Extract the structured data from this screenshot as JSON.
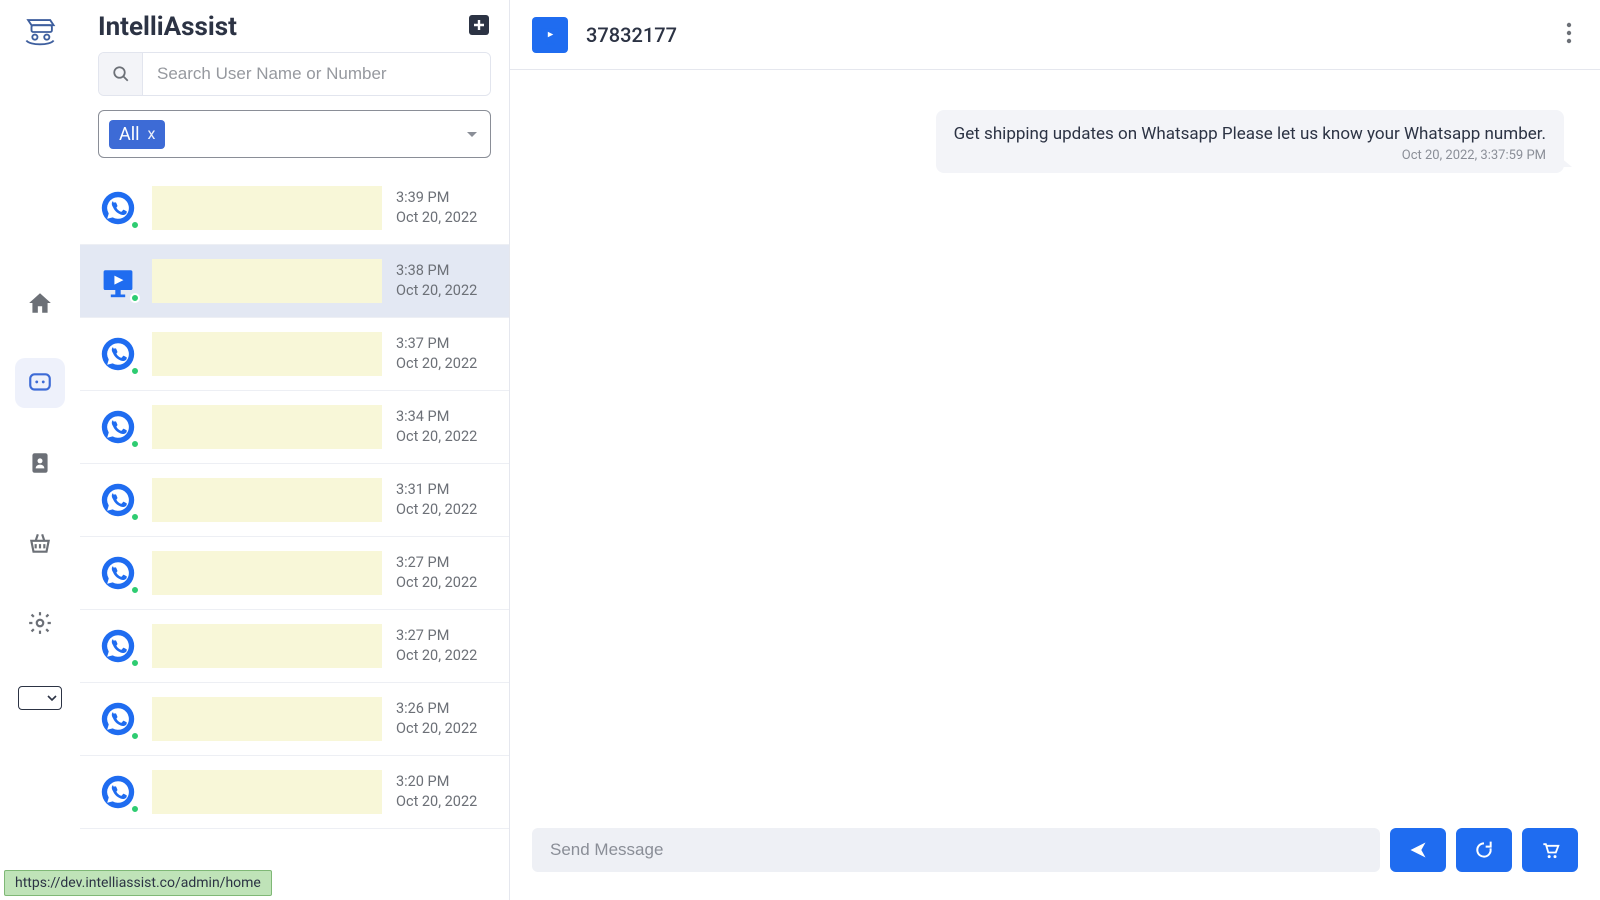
{
  "app": {
    "title": "IntelliAssist"
  },
  "search": {
    "placeholder": "Search User Name or Number"
  },
  "filter": {
    "chip_label": "All",
    "chip_remove": "x"
  },
  "conversations": [
    {
      "time": "3:39 PM",
      "date": "Oct 20, 2022",
      "type": "whatsapp"
    },
    {
      "time": "3:38 PM",
      "date": "Oct 20, 2022",
      "type": "video",
      "selected": true
    },
    {
      "time": "3:37 PM",
      "date": "Oct 20, 2022",
      "type": "whatsapp"
    },
    {
      "time": "3:34 PM",
      "date": "Oct 20, 2022",
      "type": "whatsapp"
    },
    {
      "time": "3:31 PM",
      "date": "Oct 20, 2022",
      "type": "whatsapp"
    },
    {
      "time": "3:27 PM",
      "date": "Oct 20, 2022",
      "type": "whatsapp"
    },
    {
      "time": "3:27 PM",
      "date": "Oct 20, 2022",
      "type": "whatsapp"
    },
    {
      "time": "3:26 PM",
      "date": "Oct 20, 2022",
      "type": "whatsapp"
    },
    {
      "time": "3:20 PM",
      "date": "Oct 20, 2022",
      "type": "whatsapp"
    }
  ],
  "chat": {
    "header_id": "37832177",
    "message_text": "Get shipping updates on Whatsapp Please let us know your Whatsapp number.",
    "message_time": "Oct 20, 2022, 3:37:59 PM",
    "input_placeholder": "Send Message"
  },
  "url_badge": "https://dev.intelliassist.co/admin/home",
  "icons": {
    "home": "home-icon",
    "chat": "chat-icon",
    "contacts": "contacts-icon",
    "basket": "basket-icon",
    "settings": "settings-icon"
  }
}
